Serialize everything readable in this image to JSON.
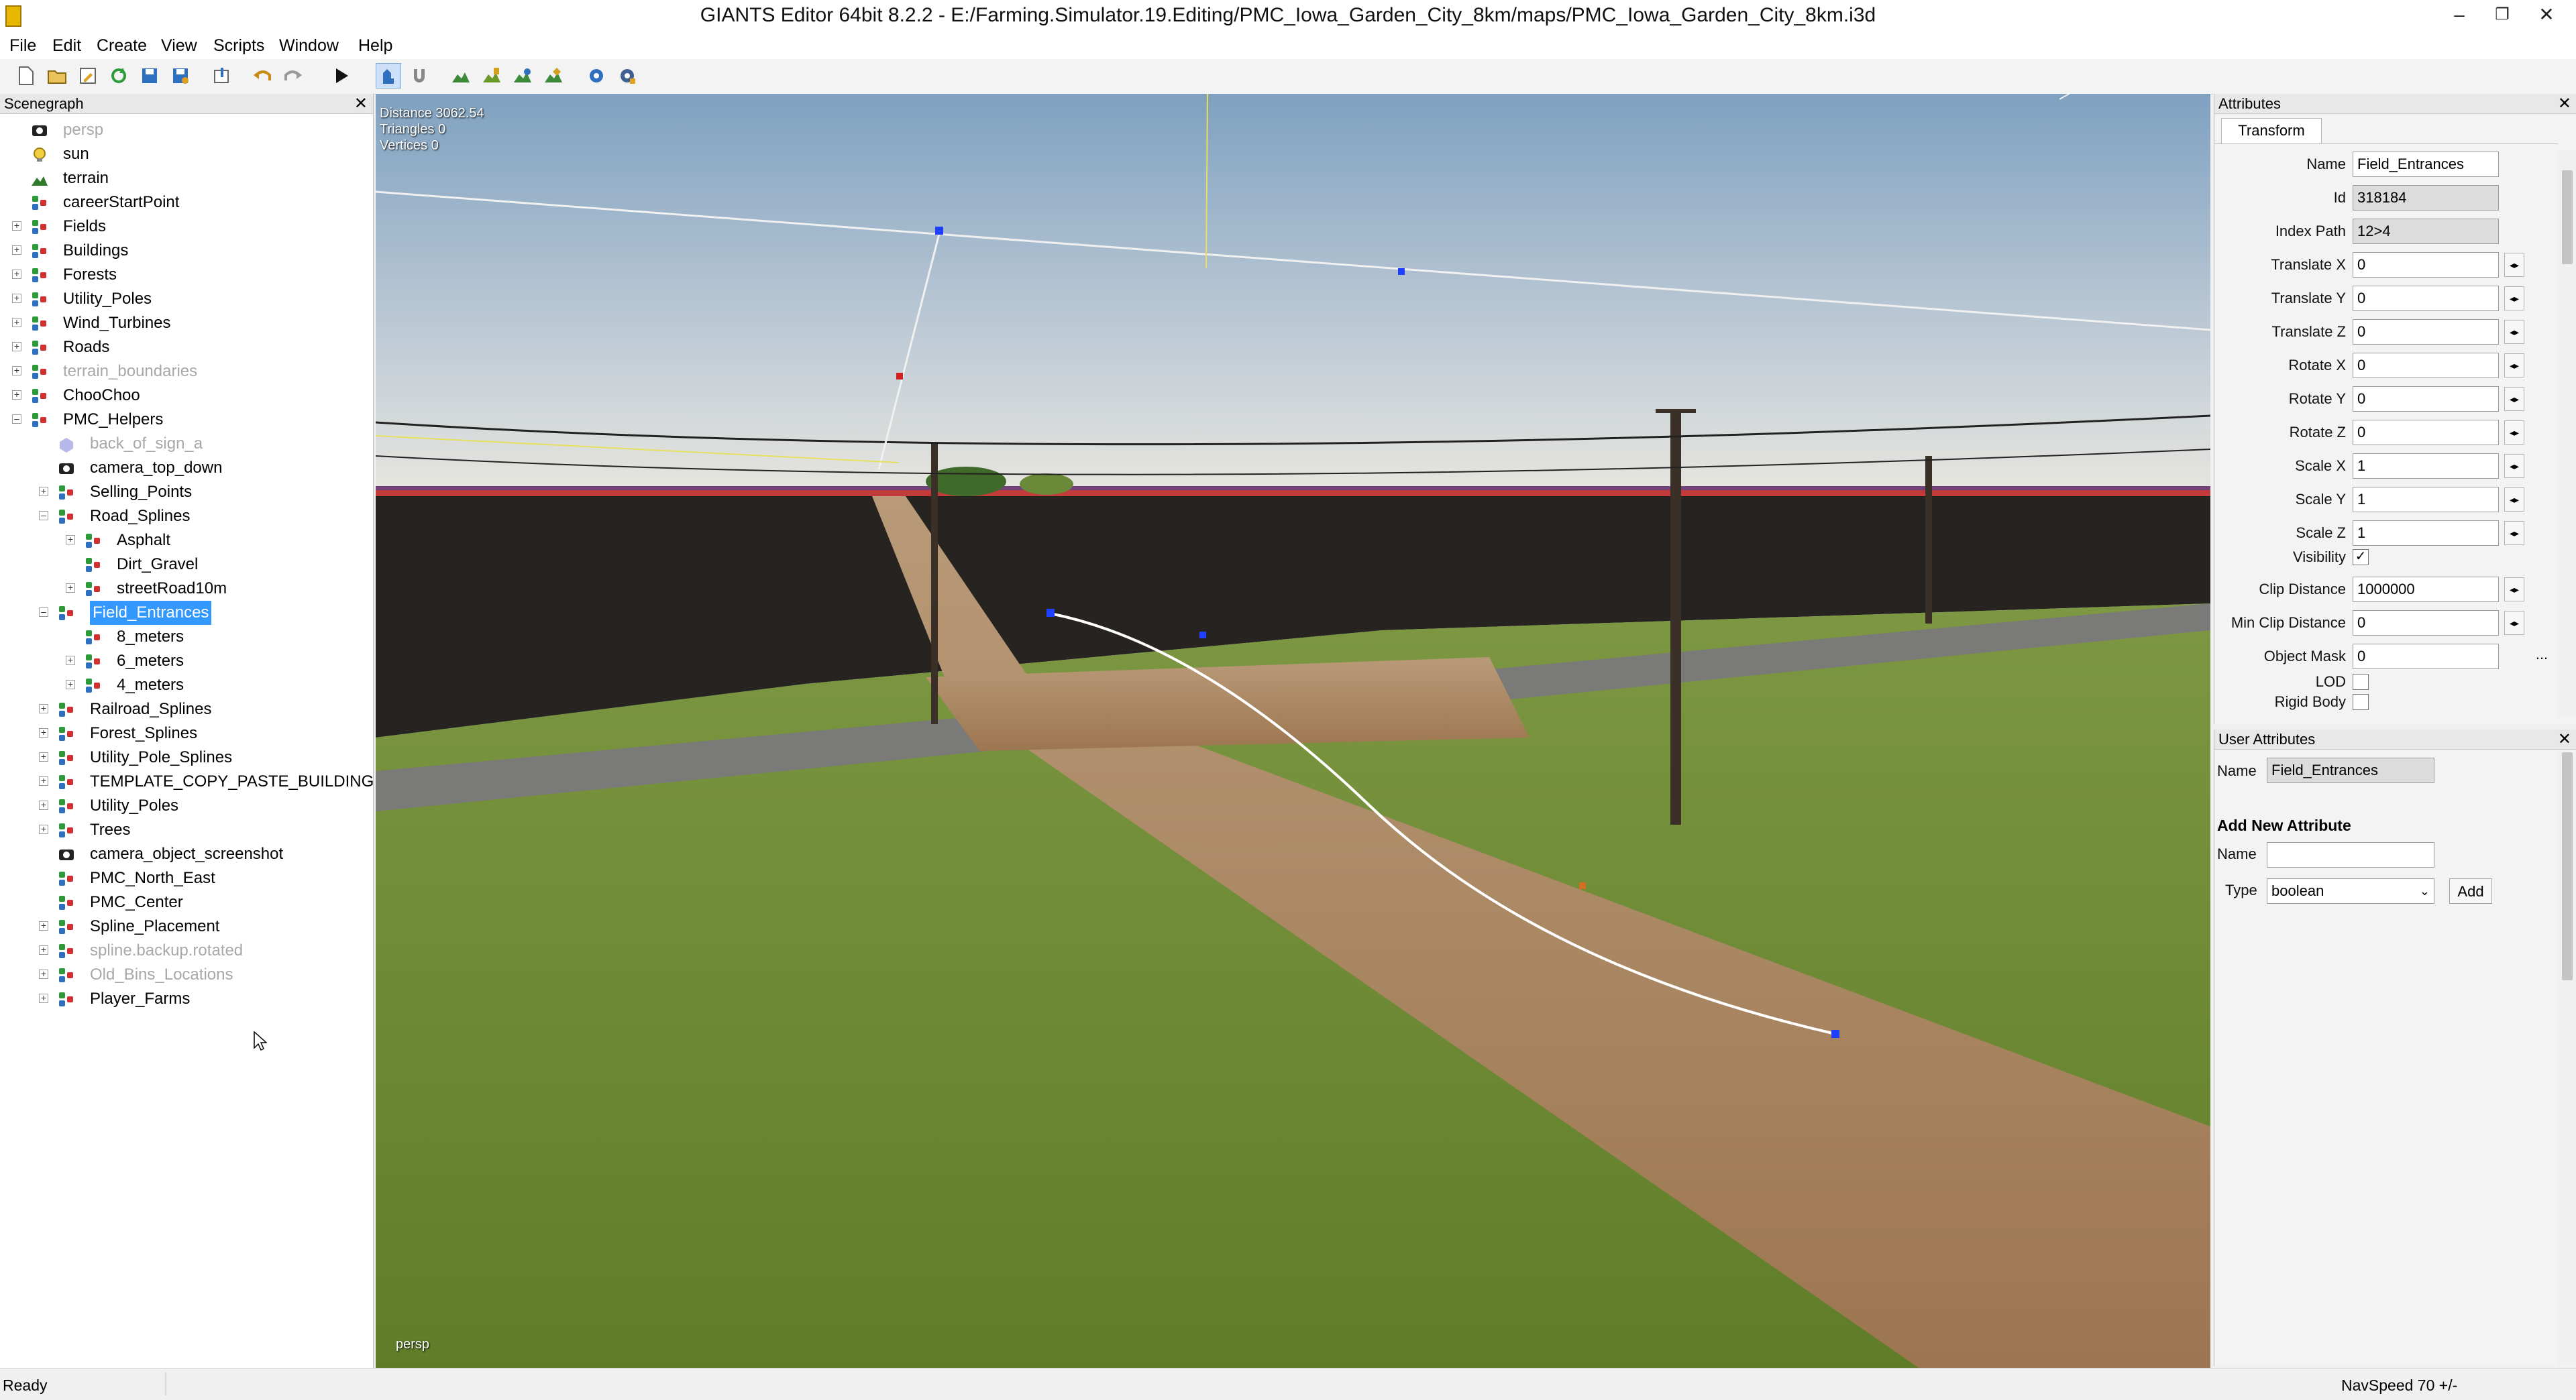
{
  "app": {
    "title": "GIANTS Editor 64bit 8.2.2 - E:/Farming.Simulator.19.Editing/PMC_Iowa_Garden_City_8km/maps/PMC_Iowa_Garden_City_8km.i3d",
    "window_controls": [
      "minimize-icon",
      "restore-icon",
      "close-icon"
    ]
  },
  "menu": [
    "File",
    "Edit",
    "Create",
    "View",
    "Scripts",
    "Window",
    "Help"
  ],
  "toolbar": {
    "icons": [
      "new-file-icon",
      "open-folder-icon",
      "edit-icon",
      "reload-icon",
      "save-icon",
      "save-as-icon",
      "import-icon",
      "undo-icon",
      "redo-icon",
      "play-icon",
      "select-tool-icon",
      "magnet-icon",
      "terrain-sculpt-icon",
      "terrain-paint-icon",
      "foliage-paint-icon",
      "place-object-icon",
      "settings-icon",
      "script-gear-icon"
    ],
    "active": "select-tool-icon"
  },
  "scenegraph": {
    "title": "Scenegraph",
    "items": [
      {
        "label": "persp",
        "depth": 0,
        "icon": "camera",
        "dim": true,
        "expander": ""
      },
      {
        "label": "sun",
        "depth": 0,
        "icon": "light",
        "dim": false,
        "expander": ""
      },
      {
        "label": "terrain",
        "depth": 0,
        "icon": "terrain",
        "dim": false,
        "expander": ""
      },
      {
        "label": "careerStartPoint",
        "depth": 0,
        "icon": "transform",
        "dim": false,
        "expander": ""
      },
      {
        "label": "Fields",
        "depth": 0,
        "icon": "transform",
        "dim": false,
        "expander": "+"
      },
      {
        "label": "Buildings",
        "depth": 0,
        "icon": "transform",
        "dim": false,
        "expander": "+"
      },
      {
        "label": "Forests",
        "depth": 0,
        "icon": "transform",
        "dim": false,
        "expander": "+"
      },
      {
        "label": "Utility_Poles",
        "depth": 0,
        "icon": "transform",
        "dim": false,
        "expander": "+"
      },
      {
        "label": "Wind_Turbines",
        "depth": 0,
        "icon": "transform",
        "dim": false,
        "expander": "+"
      },
      {
        "label": "Roads",
        "depth": 0,
        "icon": "transform",
        "dim": false,
        "expander": "+"
      },
      {
        "label": "terrain_boundaries",
        "depth": 0,
        "icon": "transform",
        "dim": true,
        "expander": "+"
      },
      {
        "label": "ChooChoo",
        "depth": 0,
        "icon": "transform",
        "dim": false,
        "expander": "+"
      },
      {
        "label": "PMC_Helpers",
        "depth": 0,
        "icon": "transform",
        "dim": false,
        "expander": "-"
      },
      {
        "label": "back_of_sign_a",
        "depth": 1,
        "icon": "shape",
        "dim": true,
        "expander": ""
      },
      {
        "label": "camera_top_down",
        "depth": 1,
        "icon": "camera",
        "dim": false,
        "expander": ""
      },
      {
        "label": "Selling_Points",
        "depth": 1,
        "icon": "transform",
        "dim": false,
        "expander": "+"
      },
      {
        "label": "Road_Splines",
        "depth": 1,
        "icon": "transform",
        "dim": false,
        "expander": "-"
      },
      {
        "label": "Asphalt",
        "depth": 2,
        "icon": "transform",
        "dim": false,
        "expander": "+"
      },
      {
        "label": "Dirt_Gravel",
        "depth": 2,
        "icon": "transform",
        "dim": false,
        "expander": ""
      },
      {
        "label": "streetRoad10m",
        "depth": 2,
        "icon": "transform",
        "dim": false,
        "expander": "+"
      },
      {
        "label": "Field_Entrances",
        "depth": 1,
        "icon": "transform",
        "dim": false,
        "expander": "-",
        "selected": true
      },
      {
        "label": "8_meters",
        "depth": 2,
        "icon": "transform",
        "dim": false,
        "expander": ""
      },
      {
        "label": "6_meters",
        "depth": 2,
        "icon": "transform",
        "dim": false,
        "expander": "+"
      },
      {
        "label": "4_meters",
        "depth": 2,
        "icon": "transform",
        "dim": false,
        "expander": "+"
      },
      {
        "label": "Railroad_Splines",
        "depth": 1,
        "icon": "transform",
        "dim": false,
        "expander": "+"
      },
      {
        "label": "Forest_Splines",
        "depth": 1,
        "icon": "transform",
        "dim": false,
        "expander": "+"
      },
      {
        "label": "Utility_Pole_Splines",
        "depth": 1,
        "icon": "transform",
        "dim": false,
        "expander": "+"
      },
      {
        "label": "TEMPLATE_COPY_PASTE_BUILDING",
        "depth": 1,
        "icon": "transform",
        "dim": false,
        "expander": "+"
      },
      {
        "label": "Utility_Poles",
        "depth": 1,
        "icon": "transform",
        "dim": false,
        "expander": "+"
      },
      {
        "label": "Trees",
        "depth": 1,
        "icon": "transform",
        "dim": false,
        "expander": "+"
      },
      {
        "label": "camera_object_screenshot",
        "depth": 1,
        "icon": "camera",
        "dim": false,
        "expander": ""
      },
      {
        "label": "PMC_North_East",
        "depth": 1,
        "icon": "transform",
        "dim": false,
        "expander": ""
      },
      {
        "label": "PMC_Center",
        "depth": 1,
        "icon": "transform",
        "dim": false,
        "expander": ""
      },
      {
        "label": "Spline_Placement",
        "depth": 1,
        "icon": "transform",
        "dim": false,
        "expander": "+"
      },
      {
        "label": "spline.backup.rotated",
        "depth": 1,
        "icon": "transform",
        "dim": true,
        "expander": "+"
      },
      {
        "label": "Old_Bins_Locations",
        "depth": 1,
        "icon": "transform",
        "dim": true,
        "expander": "+"
      },
      {
        "label": "Player_Farms",
        "depth": 1,
        "icon": "transform",
        "dim": false,
        "expander": "+"
      }
    ]
  },
  "viewport": {
    "stats": [
      "Distance 3062.54",
      "Triangles 0",
      "Vertices 0"
    ],
    "camera_label": "persp",
    "colors": {
      "sky_top": "#7fa1c0",
      "sky_bottom": "#e8e6df",
      "field_dark": "#262321",
      "grass": "#6f8a34",
      "dirt": "#a8825a",
      "spline": "#ffffff"
    }
  },
  "attributes": {
    "title": "Attributes",
    "tab": "Transform",
    "fields": [
      {
        "label": "Name",
        "value": "Field_Entrances",
        "kind": "text"
      },
      {
        "label": "Id",
        "value": "318184",
        "kind": "readonly"
      },
      {
        "label": "Index Path",
        "value": "12>4",
        "kind": "readonly"
      },
      {
        "label": "Translate X",
        "value": "0",
        "kind": "spin"
      },
      {
        "label": "Translate Y",
        "value": "0",
        "kind": "spin"
      },
      {
        "label": "Translate Z",
        "value": "0",
        "kind": "spin"
      },
      {
        "label": "Rotate X",
        "value": "0",
        "kind": "spin"
      },
      {
        "label": "Rotate Y",
        "value": "0",
        "kind": "spin"
      },
      {
        "label": "Rotate Z",
        "value": "0",
        "kind": "spin"
      },
      {
        "label": "Scale X",
        "value": "1",
        "kind": "spin"
      },
      {
        "label": "Scale Y",
        "value": "1",
        "kind": "spin"
      },
      {
        "label": "Scale Z",
        "value": "1",
        "kind": "spin"
      },
      {
        "label": "Visibility",
        "value": "✓",
        "kind": "check"
      },
      {
        "label": "Clip Distance",
        "value": "1000000",
        "kind": "spin"
      },
      {
        "label": "Min Clip Distance",
        "value": "0",
        "kind": "spin"
      },
      {
        "label": "Object Mask",
        "value": "0",
        "kind": "more"
      },
      {
        "label": "LOD",
        "value": "",
        "kind": "check"
      },
      {
        "label": "Rigid Body",
        "value": "",
        "kind": "check"
      }
    ],
    "more_label": "..."
  },
  "user_attributes": {
    "title": "User Attributes",
    "name_label": "Name",
    "name_value": "Field_Entrances",
    "add_heading": "Add New Attribute",
    "new_name_label": "Name",
    "new_name_value": "",
    "type_label": "Type",
    "type_value": "boolean",
    "add_button": "Add"
  },
  "status": {
    "left": "Ready",
    "right": "NavSpeed 70 +/-"
  }
}
